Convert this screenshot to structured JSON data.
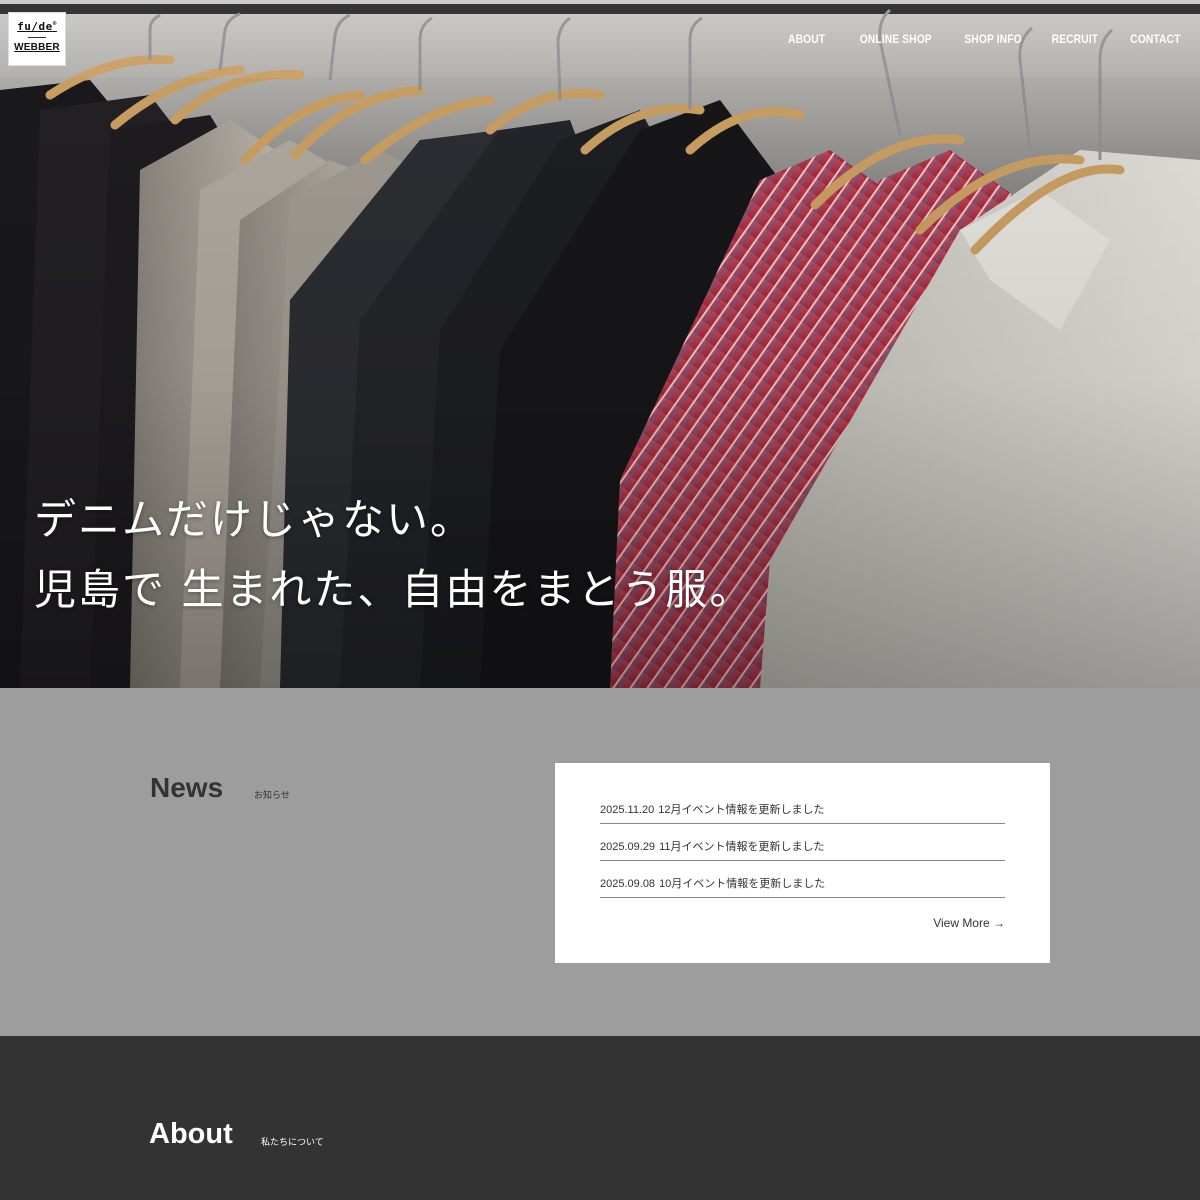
{
  "brand": {
    "logo_top": "fu/de",
    "logo_mark": "®",
    "logo_bottom": "WEBBER"
  },
  "nav": {
    "items": [
      "ABOUT",
      "ONLINE SHOP",
      "SHOP INFO",
      "RECRUIT",
      "CONTACT"
    ]
  },
  "hero": {
    "line1": "デニムだけじゃない。",
    "line2": "児島で 生まれた、自由をまとう服。",
    "image": "clothing-rack-photo"
  },
  "news": {
    "title": "News",
    "subtitle": "お知らせ",
    "items": [
      {
        "date": "2025.11.20",
        "text": "12月イベント情報を更新しました"
      },
      {
        "date": "2025.09.29",
        "text": "11月イベント情報を更新しました"
      },
      {
        "date": "2025.09.08",
        "text": "10月イベント情報を更新しました"
      }
    ],
    "view_more": "View More →"
  },
  "about": {
    "title": "About",
    "subtitle": "私たちについて"
  },
  "colors": {
    "news_bg": "#9d9d9d",
    "about_bg": "#333333",
    "card_bg": "#ffffff",
    "shirt_red": "#d4485a",
    "shirt_white": "#e4e2dc",
    "denim": "#2a2d33"
  }
}
